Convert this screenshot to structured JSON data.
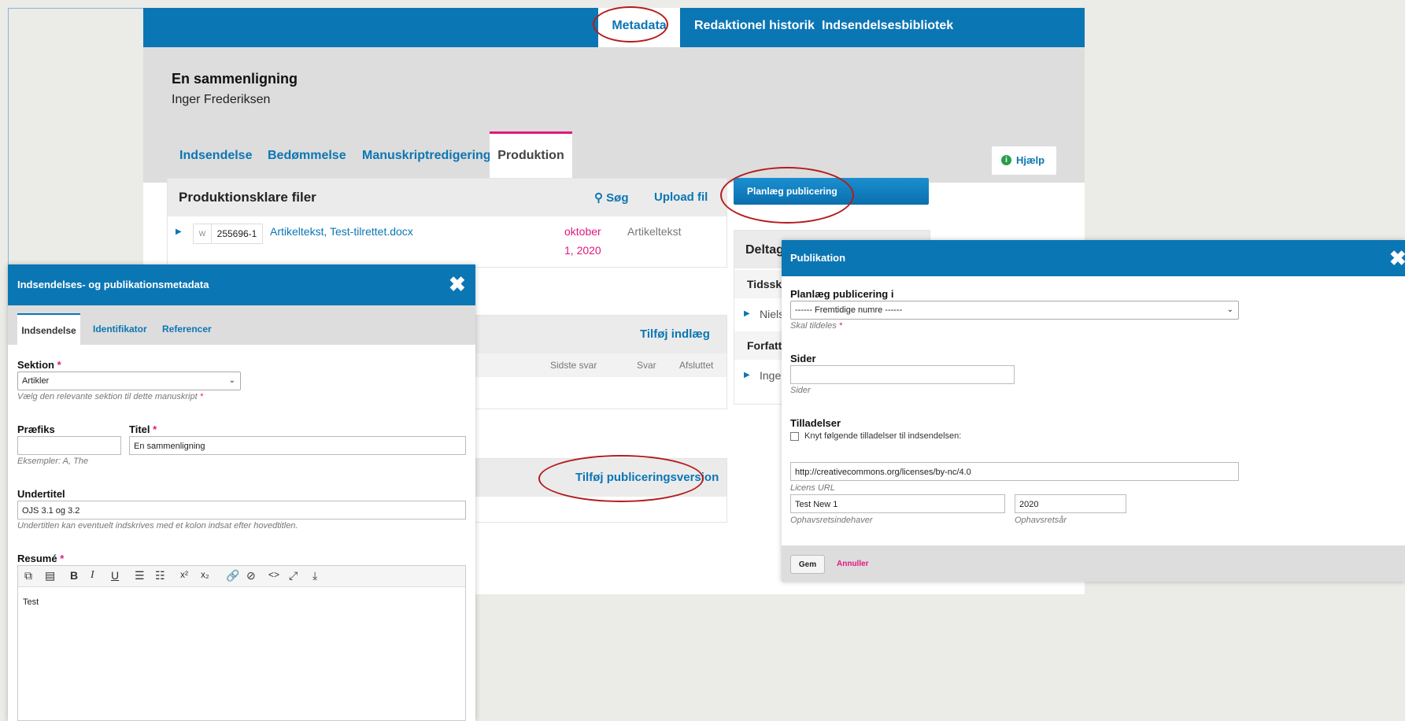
{
  "topnav": {
    "metadata": "Metadata",
    "history": "Redaktionel historik",
    "library": "Indsendelsesbibliotek"
  },
  "submission": {
    "title": "En sammenligning",
    "author": "Inger Frederiksen"
  },
  "workflow_tabs": [
    "Indsendelse",
    "Bedømmelse",
    "Manuskriptredigering",
    "Produktion"
  ],
  "help": {
    "icon": "info-icon",
    "label": "Hjælp"
  },
  "production_files": {
    "title": "Produktionsklare filer",
    "search": "Søg",
    "upload": "Upload fil",
    "file": {
      "id": "255696-1",
      "name": "Artikeltekst, Test-tilrettet.docx",
      "date_line1": "oktober",
      "date_line2": "1, 2020",
      "type": "Artikeltekst"
    }
  },
  "schedule_button": "Planlæg publicering",
  "participants": {
    "title": "Deltag",
    "journal": "Tidsskr",
    "person1": "Niels",
    "authors": "Forfatt",
    "person2": "Inge"
  },
  "discussion": {
    "add": "Tilføj indlæg",
    "col_last_reply": "Sidste svar",
    "col_replies": "Svar",
    "col_closed": "Afsluttet"
  },
  "galleys": {
    "add": "Tilføj publiceringsversion"
  },
  "metadata_modal": {
    "title": "Indsendelses- og publikationsmetadata",
    "tabs": [
      "Indsendelse",
      "Identifikator",
      "Referencer"
    ],
    "section_label": "Sektion",
    "section_value": "Artikler",
    "section_hint": "Vælg den relevante sektion til dette manuskript",
    "prefix_label": "Præfiks",
    "prefix_value": "",
    "prefix_hint": "Eksempler: A, The",
    "title_label": "Titel",
    "title_value": "En sammenligning",
    "subtitle_label": "Undertitel",
    "subtitle_value": "OJS 3.1 og 3.2",
    "subtitle_hint": "Undertitlen kan eventuelt indskrives med et kolon indsat efter hovedtitlen.",
    "abstract_label": "Resumé",
    "abstract_value": "Test",
    "toolbar_icons": [
      "copy-icon",
      "paste-icon",
      "bold-icon",
      "italic-icon",
      "underline-icon",
      "bullet-list-icon",
      "numbered-list-icon",
      "superscript-icon",
      "subscript-icon",
      "link-icon",
      "unlink-icon",
      "code-icon",
      "fullscreen-icon",
      "upload-icon"
    ]
  },
  "publication_modal": {
    "title": "Publikation",
    "schedule_label": "Planlæg publicering i",
    "schedule_value": "------ Fremtidige numre ------",
    "schedule_hint": "Skal tildeles",
    "pages_label": "Sider",
    "pages_value": "",
    "pages_hint": "Sider",
    "permissions_label": "Tilladelser",
    "permissions_checkbox": "Knyt følgende tilladelser til indsendelsen:",
    "license_value": "http://creativecommons.org/licenses/by-nc/4.0",
    "license_hint": "Licens URL",
    "holder_value": "Test New 1",
    "holder_hint": "Ophavsretsindehaver",
    "year_value": "2020",
    "year_hint": "Ophavsretsår",
    "save": "Gem",
    "cancel": "Annuller"
  },
  "colors": {
    "primary": "#0b76b4",
    "accent": "#e0197d",
    "annotation": "#b51b1b"
  }
}
